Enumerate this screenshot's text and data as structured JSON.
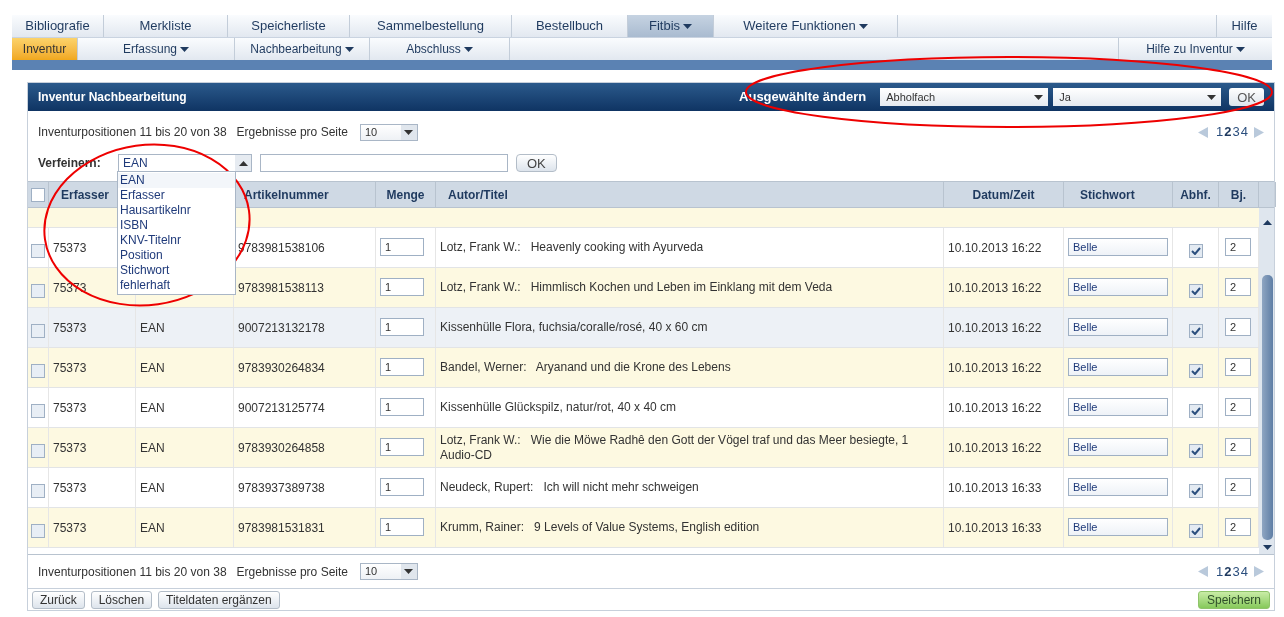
{
  "main_menu": {
    "items": [
      {
        "label": "Bibliografie",
        "selected": false,
        "has_menu": false
      },
      {
        "label": "Merkliste",
        "selected": false,
        "has_menu": false
      },
      {
        "label": "Speicherliste",
        "selected": false,
        "has_menu": false
      },
      {
        "label": "Sammelbestellung",
        "selected": false,
        "has_menu": false
      },
      {
        "label": "Bestellbuch",
        "selected": false,
        "has_menu": false
      },
      {
        "label": "Fitbis",
        "selected": true,
        "has_menu": true
      },
      {
        "label": "Weitere Funktionen",
        "selected": false,
        "has_menu": true
      }
    ],
    "right_items": [
      {
        "label": "Hilfe",
        "selected": false,
        "has_menu": false
      }
    ]
  },
  "sub_menu": {
    "items": [
      {
        "label": "Inventur",
        "selected": true,
        "has_menu": false
      },
      {
        "label": "Erfassung",
        "selected": false,
        "has_menu": true
      },
      {
        "label": "Nachbearbeitung",
        "selected": false,
        "has_menu": true
      },
      {
        "label": "Abschluss",
        "selected": false,
        "has_menu": true
      }
    ],
    "right_items": [
      {
        "label": "Hilfe zu Inventur",
        "selected": false,
        "has_menu": true
      }
    ]
  },
  "panel": {
    "title": "Inventur Nachbearbeitung",
    "bulk_label": "Ausgewählte ändern",
    "bulk_field": "Abholfach",
    "bulk_value": "Ja",
    "bulk_button": "OK"
  },
  "toolbar": {
    "range": "Inventurpositionen 11 bis 20 von 38",
    "per_page_label": "Ergebnisse pro Seite",
    "per_page": "10",
    "pages": [
      {
        "label": "1",
        "selected": false
      },
      {
        "label": "2",
        "selected": true
      },
      {
        "label": "3",
        "selected": false
      },
      {
        "label": "4",
        "selected": false
      }
    ]
  },
  "refine": {
    "label": "Verfeinern:",
    "field": "EAN",
    "button": "OK",
    "open": true,
    "options": [
      {
        "label": "EAN",
        "selected": true
      },
      {
        "label": "Erfasser",
        "selected": false
      },
      {
        "label": "Hausartikelnr",
        "selected": false
      },
      {
        "label": "ISBN",
        "selected": false
      },
      {
        "label": "KNV-Titelnr",
        "selected": false
      },
      {
        "label": "Position",
        "selected": false
      },
      {
        "label": "Stichwort",
        "selected": false
      },
      {
        "label": "fehlerhaft",
        "selected": false
      }
    ]
  },
  "table": {
    "select_all_checked": false,
    "columns": [
      "Erfasser",
      "Artikelnummer",
      "Menge",
      "Autor/Titel",
      "Datum/Zeit",
      "Stichwort",
      "Abhf.",
      "Bj."
    ],
    "rows": [
      {
        "erfasser": "75373",
        "number": "9783981538106",
        "menge": "1",
        "author": "Lotz, Frank W.:",
        "title": "Heavenly cooking with Ayurveda",
        "date": "10.10.2013 16:22",
        "stichwort": "Belle",
        "abhf": true,
        "bj": "2",
        "highlighted": false,
        "selected": false
      },
      {
        "erfasser": "75373",
        "number": "9783981538113",
        "menge": "1",
        "author": "Lotz, Frank W.:",
        "title": "Himmlisch Kochen und Leben im Einklang mit dem Veda",
        "date": "10.10.2013 16:22",
        "stichwort": "Belle",
        "abhf": true,
        "bj": "2",
        "highlighted": false,
        "selected": false
      },
      {
        "erfasser": "75373",
        "type": "EAN",
        "number": "9007213132178",
        "menge": "1",
        "title": "Kissenhülle Flora, fuchsia/coralle/rosé, 40 x 60 cm",
        "date": "10.10.2013 16:22",
        "stichwort": "Belle",
        "abhf": true,
        "bj": "2",
        "highlighted": true,
        "selected": false
      },
      {
        "erfasser": "75373",
        "type": "EAN",
        "number": "9783930264834",
        "menge": "1",
        "author": "Bandel, Werner:",
        "title": "Aryanand und die Krone des Lebens",
        "date": "10.10.2013 16:22",
        "stichwort": "Belle",
        "abhf": true,
        "bj": "2",
        "highlighted": false,
        "selected": false
      },
      {
        "erfasser": "75373",
        "type": "EAN",
        "number": "9007213125774",
        "menge": "1",
        "title": "Kissenhülle Glückspilz, natur/rot, 40 x 40 cm",
        "date": "10.10.2013 16:22",
        "stichwort": "Belle",
        "abhf": true,
        "bj": "2",
        "highlighted": false,
        "selected": false
      },
      {
        "erfasser": "75373",
        "type": "EAN",
        "number": "9783930264858",
        "menge": "1",
        "author": "Lotz, Frank W.:",
        "title": "Wie die Möwe Radhê den Gott der Vögel traf und das Meer besiegte, 1 Audio-CD",
        "date": "10.10.2013 16:22",
        "stichwort": "Belle",
        "abhf": true,
        "bj": "2",
        "highlighted": false,
        "selected": false
      },
      {
        "erfasser": "75373",
        "type": "EAN",
        "number": "9783937389738",
        "menge": "1",
        "author": "Neudeck, Rupert:",
        "title": "Ich will nicht mehr schweigen",
        "date": "10.10.2013 16:33",
        "stichwort": "Belle",
        "abhf": true,
        "bj": "2",
        "highlighted": false,
        "selected": false
      },
      {
        "erfasser": "75373",
        "type": "EAN",
        "number": "9783981531831",
        "menge": "1",
        "author": "Krumm, Rainer:",
        "title": "9 Levels of Value Systems, English edition",
        "date": "10.10.2013 16:33",
        "stichwort": "Belle",
        "abhf": true,
        "bj": "2",
        "highlighted": false,
        "selected": false
      }
    ]
  },
  "footer": {
    "range": "Inventurpositionen 11 bis 20 von 38",
    "per_page_label": "Ergebnisse pro Seite",
    "per_page": "10",
    "pages": [
      {
        "label": "1",
        "selected": false
      },
      {
        "label": "2",
        "selected": true
      },
      {
        "label": "3",
        "selected": false
      },
      {
        "label": "4",
        "selected": false
      }
    ]
  },
  "buttons": [
    {
      "label": "Zurück",
      "kind": "plain"
    },
    {
      "label": "Löschen",
      "kind": "plain"
    },
    {
      "label": "Titeldaten ergänzen",
      "kind": "plain"
    },
    {
      "label": "Speichern",
      "kind": "primary"
    }
  ]
}
